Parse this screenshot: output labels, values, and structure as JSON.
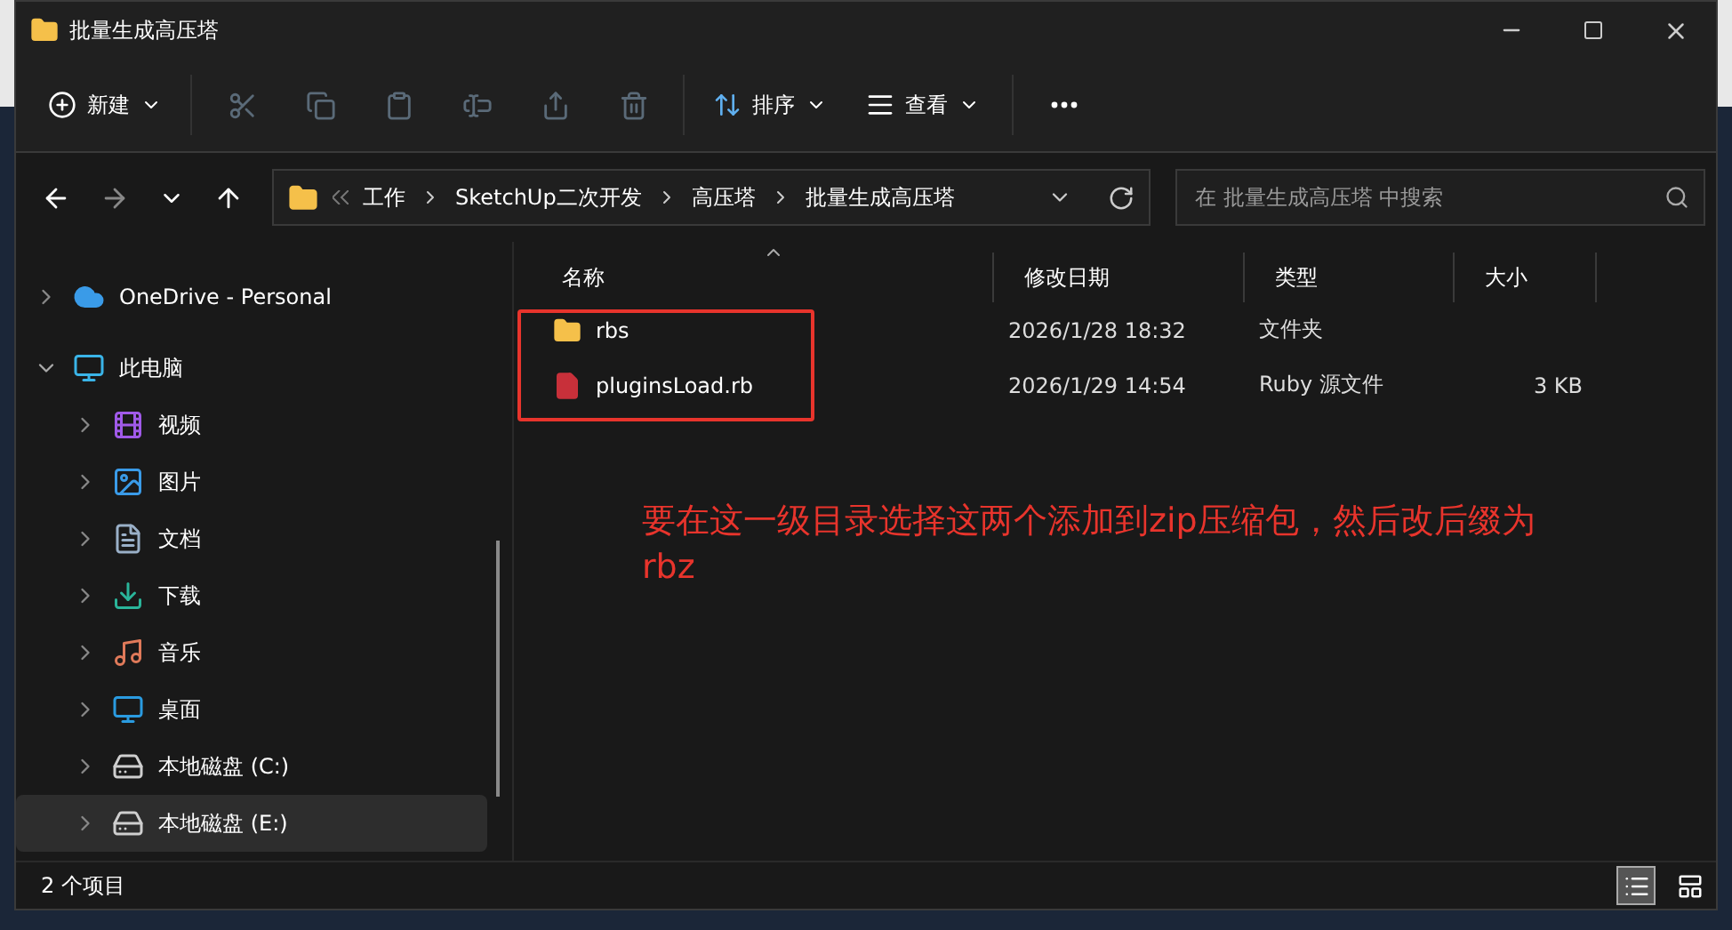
{
  "window": {
    "title": "批量生成高压塔"
  },
  "toolbar": {
    "new_label": "新建",
    "actions": [
      {
        "kind": "cut",
        "disabled": true
      },
      {
        "kind": "copy",
        "disabled": true
      },
      {
        "kind": "paste",
        "disabled": true
      },
      {
        "kind": "rename",
        "disabled": true
      },
      {
        "kind": "share",
        "disabled": true
      },
      {
        "kind": "delete",
        "disabled": true
      }
    ],
    "sort_label": "排序",
    "view_label": "查看"
  },
  "address": {
    "breadcrumb": [
      "工作",
      "SketchUp二次开发",
      "高压塔",
      "批量生成高压塔"
    ],
    "search_placeholder": "在 批量生成高压塔 中搜索"
  },
  "sidebar": {
    "items": [
      {
        "kind": "cloud",
        "label": "OneDrive - Personal",
        "expanded": false,
        "selected": false
      },
      {
        "kind": "pc",
        "label": "此电脑",
        "expanded": true,
        "selected": false,
        "children": [
          {
            "kind": "video",
            "label": "视频",
            "expanded": false,
            "selected": false
          },
          {
            "kind": "pictures",
            "label": "图片",
            "expanded": false,
            "selected": false
          },
          {
            "kind": "documents",
            "label": "文档",
            "expanded": false,
            "selected": false
          },
          {
            "kind": "downloads",
            "label": "下载",
            "expanded": false,
            "selected": false
          },
          {
            "kind": "music",
            "label": "音乐",
            "expanded": false,
            "selected": false
          },
          {
            "kind": "desktop",
            "label": "桌面",
            "expanded": false,
            "selected": false
          },
          {
            "kind": "system-drive",
            "label": "本地磁盘 (C:)",
            "expanded": false,
            "selected": false
          },
          {
            "kind": "drive",
            "label": "本地磁盘 (E:)",
            "expanded": false,
            "selected": true
          }
        ]
      }
    ]
  },
  "table": {
    "columns": [
      "名称",
      "修改日期",
      "类型",
      "大小"
    ],
    "rows": [
      {
        "kind": "folder",
        "name": "rbs",
        "modified": "2026/1/28 18:32",
        "type": "文件夹"
      },
      {
        "kind": "file",
        "name": "pluginsLoad.rb",
        "modified": "2026/1/29 14:54",
        "type": "Ruby 源文件",
        "size": "3 KB"
      }
    ]
  },
  "annotation": {
    "text": "要在这一级目录选择这两个添加到zip压缩包，然后改后缀为rbz",
    "color": "#e8342c"
  },
  "status_bar": {
    "count": "2 个项目",
    "views": [
      {
        "kind": "details",
        "selected": true
      },
      {
        "kind": "tiles",
        "selected": false
      }
    ]
  }
}
